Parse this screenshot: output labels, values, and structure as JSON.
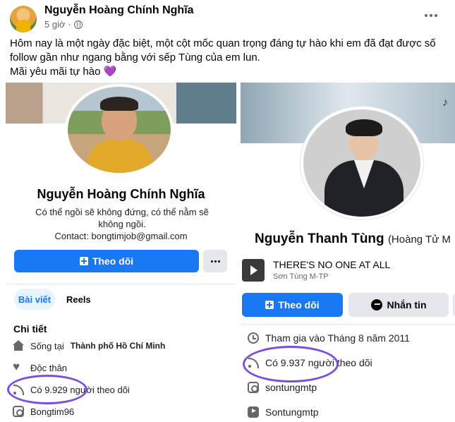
{
  "post": {
    "author": "Nguyễn Hoàng Chính Nghĩa",
    "time": "5 giờ",
    "text_line1": "Hôm nay là một ngày đặc biệt, một cột mốc quan trọng đáng tự hào khi em đã đạt được số",
    "text_line2": "follow gần như ngang bằng với sếp Tùng của em lun.",
    "text_line3": "Mãi yêu mãi tự hào 💜"
  },
  "left_profile": {
    "name": "Nguyễn Hoàng Chính Nghĩa",
    "bio": "Có thể ngồi sẽ không đứng, có thể nằm sẽ không ngồi.",
    "contact": "Contact: bongtimjob@gmail.com",
    "follow_label": "Theo dõi",
    "tabs": [
      "Bài viết",
      "Reels"
    ],
    "section_title": "Chi tiết",
    "details": {
      "lives_prefix": "Sống tại",
      "lives_city": "Thành phố Hồ Chí Minh",
      "relationship": "Độc thân",
      "followers": "Có 9.929 người theo dõi",
      "instagram": "Bongtim96"
    }
  },
  "right_profile": {
    "name": "Nguyễn Thanh Tùng",
    "alt_name": "(Hoàng Tử M",
    "music_title": "THERE'S NO ONE AT ALL",
    "music_artist": "Sơn Tùng M-TP",
    "follow_label": "Theo dõi",
    "message_label": "Nhắn tin",
    "details": {
      "joined": "Tham gia vào Tháng 8 năm 2011",
      "followers": "Có 9.937 người theo dõi",
      "instagram": "sontungmtp",
      "youtube": "Sontungmtp"
    }
  },
  "colors": {
    "accent": "#1877f2",
    "highlight": "#7b4ee0",
    "text_secondary": "#65676b"
  },
  "icons": [
    "globe-icon",
    "more-icon",
    "plus-icon",
    "home-icon",
    "heart-icon",
    "rss-icon",
    "instagram-icon",
    "youtube-icon",
    "clock-icon",
    "messenger-icon",
    "play-icon"
  ]
}
